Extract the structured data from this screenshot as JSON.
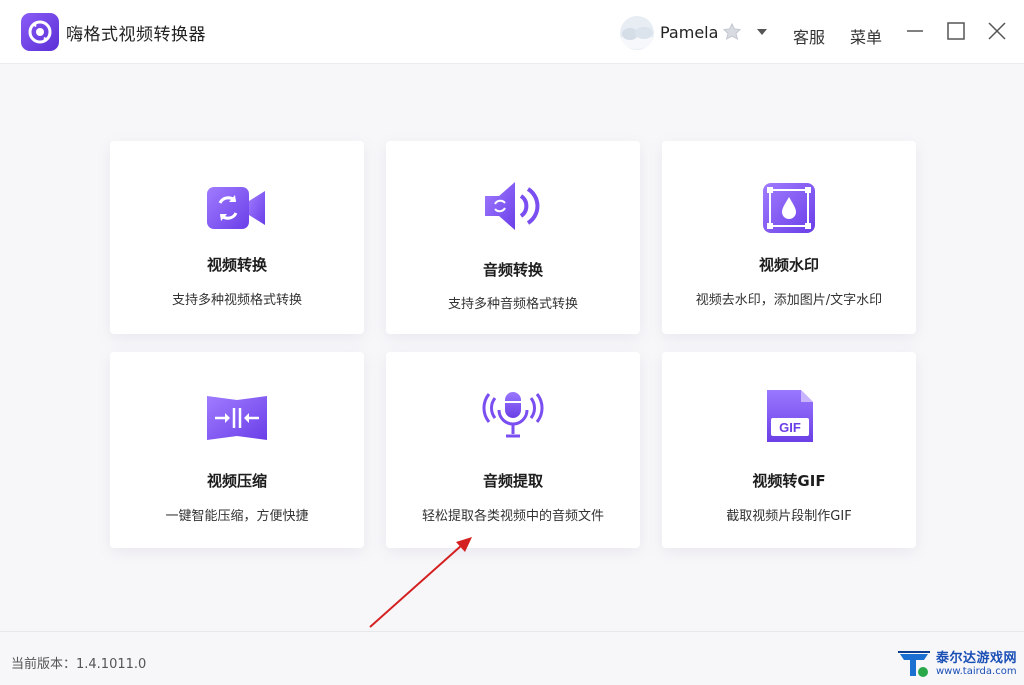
{
  "app": {
    "title": "嗨格式视频转换器",
    "logo_icon": "app-logo-icon",
    "accent": "#7b4ff0"
  },
  "header": {
    "user_name": "Pamela",
    "vip_icon": "vip-badge-icon",
    "dropdown_icon": "chevron-down-icon",
    "service_label": "客服",
    "menu_label": "菜单",
    "window_controls": [
      "minimize-icon",
      "maximize-icon",
      "close-icon"
    ]
  },
  "cards": [
    {
      "id": "video-convert",
      "title": "视频转换",
      "desc": "支持多种视频格式转换",
      "icon": "video-convert-icon"
    },
    {
      "id": "audio-convert",
      "title": "音频转换",
      "desc": "支持多种音频格式转换",
      "icon": "audio-convert-icon"
    },
    {
      "id": "video-watermark",
      "title": "视频水印",
      "desc": "视频去水印，添加图片/文字水印",
      "icon": "watermark-icon"
    },
    {
      "id": "video-compress",
      "title": "视频压缩",
      "desc": "一键智能压缩，方便快捷",
      "icon": "compress-icon"
    },
    {
      "id": "audio-extract",
      "title": "音频提取",
      "desc": "轻松提取各类视频中的音频文件",
      "icon": "microphone-icon"
    },
    {
      "id": "video-gif",
      "title": "视频转GIF",
      "desc": "截取视频片段制作GIF",
      "icon": "gif-file-icon"
    }
  ],
  "gif_icon_label": "GIF",
  "footer": {
    "version_label": "当前版本：1.4.1011.0"
  },
  "watermark": {
    "name": "泰尔达游戏网",
    "url": "www.tairda.com"
  },
  "annotation": {
    "arrow_color": "#d42020"
  }
}
